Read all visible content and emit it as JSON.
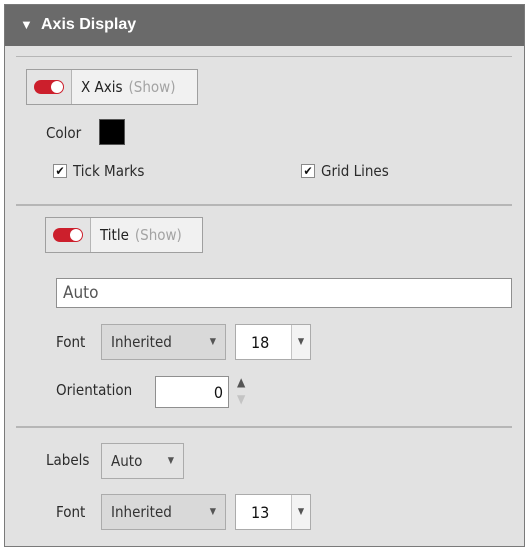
{
  "header": {
    "title": "Axis Display",
    "collapse_icon": "triangle-down-icon"
  },
  "axis_toggle": {
    "label": "X Axis",
    "state_text": "(Show)",
    "on": true
  },
  "color": {
    "label": "Color",
    "value": "#000000"
  },
  "tick_marks": {
    "label": "Tick Marks",
    "checked": true
  },
  "grid_lines": {
    "label": "Grid Lines",
    "checked": true
  },
  "title_section": {
    "toggle": {
      "label": "Title",
      "state_text": "(Show)",
      "on": true
    },
    "text_value": "Auto",
    "font_label": "Font",
    "font_value": "Inherited",
    "size_value": "18",
    "orientation_label": "Orientation",
    "orientation_value": "0"
  },
  "labels_section": {
    "labels_label": "Labels",
    "labels_value": "Auto",
    "font_label": "Font",
    "font_value": "Inherited",
    "size_value": "13"
  },
  "colors": {
    "toggle_on": "#cc1f2c",
    "header_bg": "#6a6a6a",
    "panel_bg": "#e2e2e2"
  }
}
